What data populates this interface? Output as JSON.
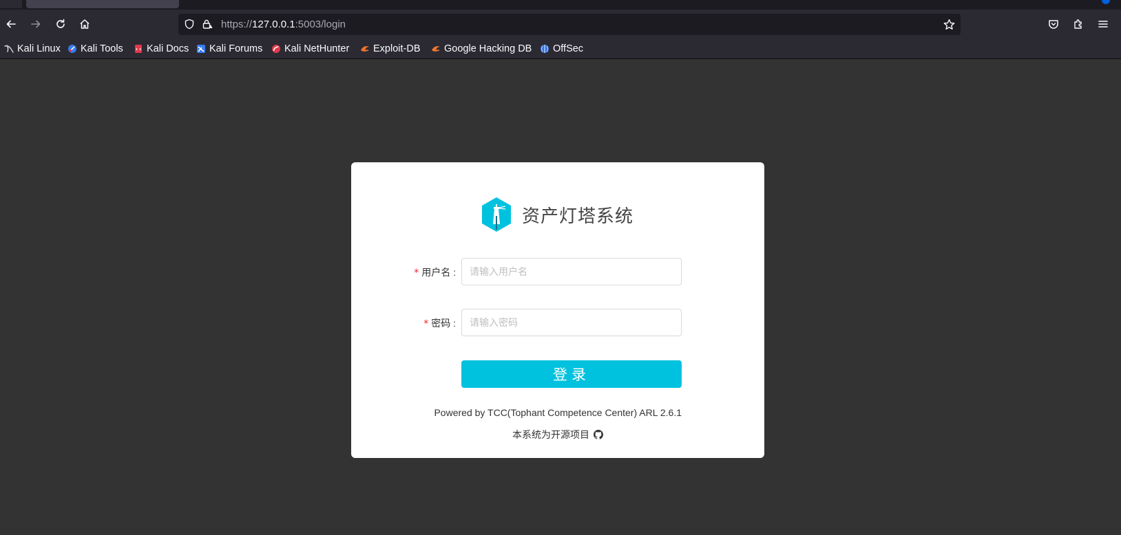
{
  "browser": {
    "url_scheme": "https://",
    "url_host": "127.0.0.1",
    "url_path": ":5003/login",
    "bookmarks": [
      {
        "label": "Kali Linux",
        "icon": "kali-dragon-icon"
      },
      {
        "label": "Kali Tools",
        "icon": "kali-tools-icon"
      },
      {
        "label": "Kali Docs",
        "icon": "kali-docs-icon"
      },
      {
        "label": "Kali Forums",
        "icon": "kali-forums-icon"
      },
      {
        "label": "Kali NetHunter",
        "icon": "kali-nethunter-icon"
      },
      {
        "label": "Exploit-DB",
        "icon": "exploit-db-icon"
      },
      {
        "label": "Google Hacking DB",
        "icon": "ghdb-icon"
      },
      {
        "label": "OffSec",
        "icon": "offsec-icon"
      }
    ]
  },
  "login": {
    "title": "资产灯塔系统",
    "username_label": "用户名",
    "username_placeholder": "请输入用户名",
    "password_label": "密码",
    "password_placeholder": "请输入密码",
    "submit_label": "登录",
    "required_mark": "*",
    "label_colon": ":",
    "powered_by": "Powered by TCC(Tophant Competence Center) ARL 2.6.1",
    "open_source_text": "本系统为开源项目"
  },
  "colors": {
    "page_bg": "#333333",
    "accent": "#00c2de",
    "required": "#f5222d"
  }
}
